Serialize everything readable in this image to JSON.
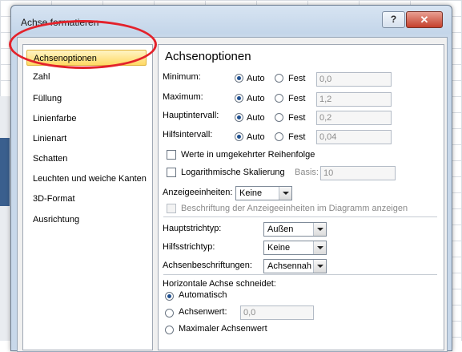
{
  "window": {
    "title": "Achse formatieren",
    "help_label": "?",
    "close_label": "✕"
  },
  "nav": {
    "items": [
      "Achsenoptionen",
      "Zahl",
      "Füllung",
      "Linienfarbe",
      "Linienart",
      "Schatten",
      "Leuchten und weiche Kanten",
      "3D-Format",
      "Ausrichtung"
    ]
  },
  "panel": {
    "heading": "Achsenoptionen",
    "auto_label": "Auto",
    "fixed_label": "Fest",
    "rows": [
      {
        "label": "Minimum:",
        "value": "0,0"
      },
      {
        "label": "Maximum:",
        "value": "1,2"
      },
      {
        "label": "Hauptintervall:",
        "value": "0,2"
      },
      {
        "label": "Hilfsintervall:",
        "value": "0,04"
      }
    ],
    "reverse_order_label": "Werte in umgekehrter Reihenfolge",
    "log_scale_label": "Logarithmische Skalierung",
    "basis_label": "Basis:",
    "basis_value": "10",
    "display_units_label": "Anzeigeeinheiten:",
    "display_units_value": "Keine",
    "display_units_caption_label": "Beschriftung der Anzeigeeinheiten im Diagramm anzeigen",
    "major_tick_label": "Hauptstrichtyp:",
    "major_tick_value": "Außen",
    "minor_tick_label": "Hilfsstrichtyp:",
    "minor_tick_value": "Keine",
    "axis_labels_label": "Achsenbeschriftungen:",
    "axis_labels_value": "Achsennah",
    "cross_heading": "Horizontale Achse schneidet:",
    "cross_auto_label": "Automatisch",
    "cross_value_label": "Achsenwert:",
    "cross_value": "0,0",
    "cross_max_label": "Maximaler Achsenwert"
  }
}
